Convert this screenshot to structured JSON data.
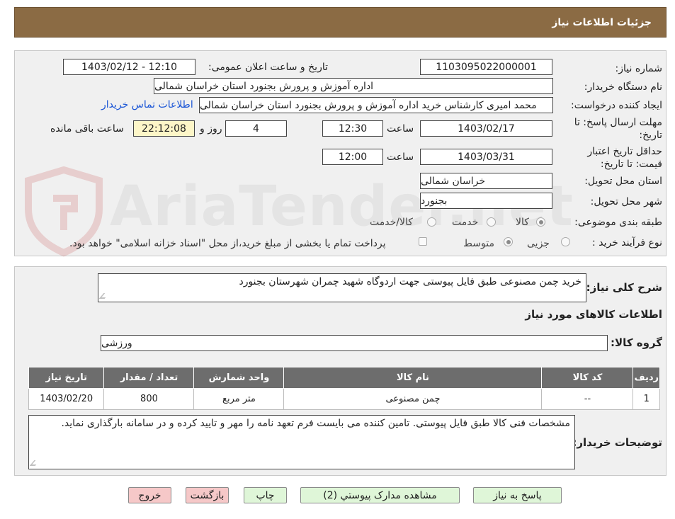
{
  "header": {
    "title": "جزئیات اطلاعات نیاز"
  },
  "form": {
    "need_number": {
      "label": "شماره نیاز:",
      "value": "1103095022000001"
    },
    "announce_datetime": {
      "label": "تاریخ و ساعت اعلان عمومی:",
      "value": "1403/02/12 - 12:10"
    },
    "buyer_org": {
      "label": "نام دستگاه خریدار:",
      "value": "اداره آموزش و پرورش بجنورد استان خراسان شمالی"
    },
    "requester": {
      "label": "ایجاد کننده درخواست:",
      "value": "محمد امیری کارشناس خرید اداره آموزش و پرورش بجنورد استان خراسان شمالی",
      "contact_link": "اطلاعات تماس خریدار"
    },
    "deadline": {
      "label_line1": "مهلت ارسال پاسخ: تا",
      "label_line2": "تاریخ:",
      "date": "1403/02/17",
      "time_label": "ساعت",
      "time": "12:30",
      "days": "4",
      "days_label": "روز و",
      "remaining": "22:12:08",
      "remaining_label": "ساعت باقی مانده"
    },
    "validity": {
      "label_line1": "حداقل تاریخ اعتبار",
      "label_line2": "قیمت: تا تاریخ:",
      "date": "1403/03/31",
      "time_label": "ساعت",
      "time": "12:00"
    },
    "province": {
      "label": "استان محل تحویل:",
      "value": "خراسان شمالی"
    },
    "city": {
      "label": "شهر محل تحویل:",
      "value": "بجنورد"
    },
    "category": {
      "label": "طبقه بندی موضوعی:",
      "options": [
        "کالا",
        "خدمت",
        "کالا/خدمت"
      ],
      "selected": "کالا"
    },
    "process": {
      "label": "نوع فرآیند خرید :",
      "options": [
        "جزیی",
        "متوسط"
      ],
      "selected": "متوسط",
      "payment_note": "پرداخت تمام یا بخشی از مبلغ خرید،از محل \"اسناد خزانه اسلامی\" خواهد بود."
    }
  },
  "summary": {
    "label": "شرح کلی نیاز:",
    "value": "خرید چمن مصنوعی طبق فایل پیوستی جهت اردوگاه شهید چمران شهرستان بجنورد"
  },
  "goods_section": {
    "title": "اطلاعات کالاهای مورد نیاز"
  },
  "goods_group": {
    "label": "گروه کالا:",
    "value": "ورزشی"
  },
  "items_table": {
    "headers": [
      "ردیف",
      "کد کالا",
      "نام کالا",
      "واحد شمارش",
      "تعداد / مقدار",
      "تاریخ نیاز"
    ],
    "rows": [
      [
        "1",
        "--",
        "چمن مصنوعی",
        "متر مربع",
        "800",
        "1403/02/20"
      ]
    ]
  },
  "buyer_notes": {
    "label": "توضیحات خریدار:",
    "value": "مشخصات فنی کالا طبق فایل پیوستی. تامین کننده می بایست فرم تعهد نامه را مهر و تایید کرده و در سامانه بارگذاری نماید."
  },
  "buttons": {
    "reply": "پاسخ به نیاز",
    "attachments": "مشاهده مدارک پیوستي (2)",
    "print": "چاپ",
    "back": "بازگشت",
    "exit": "خروج"
  },
  "watermark": {
    "text": "AriaTender.net"
  },
  "colors": {
    "header_bg": "#8b6b44",
    "table_header_bg": "#6d6d6d",
    "button_green": "#dff6d8",
    "button_pink": "#f6c8c8",
    "link": "#1a55d6",
    "remaining_bg": "#fdf6c8"
  }
}
